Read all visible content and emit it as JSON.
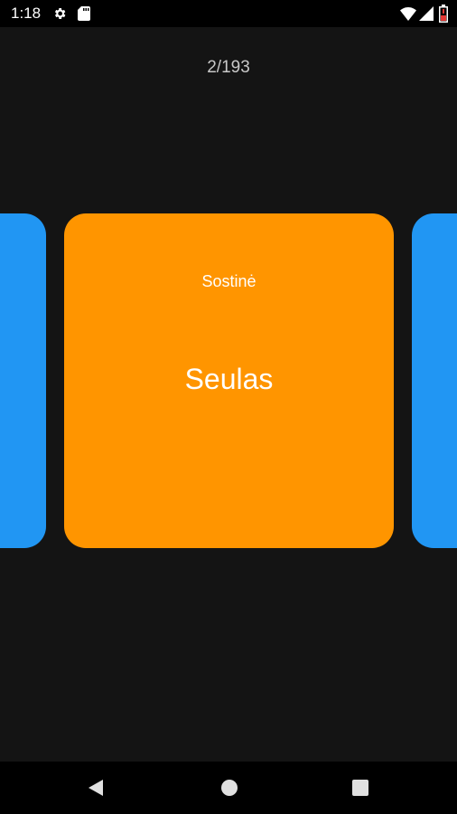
{
  "status_bar": {
    "time": "1:18",
    "icons": [
      "settings-icon",
      "sd-card-icon",
      "wifi-icon",
      "signal-icon",
      "battery-icon"
    ]
  },
  "counter": "2/193",
  "cards": {
    "prev_color": "#2196F3",
    "next_color": "#2196F3",
    "current": {
      "label": "Sostinė",
      "value": "Seulas",
      "color": "#FF9500"
    }
  },
  "nav_bar": {
    "icons": [
      "back-icon",
      "home-icon",
      "recents-icon"
    ]
  }
}
